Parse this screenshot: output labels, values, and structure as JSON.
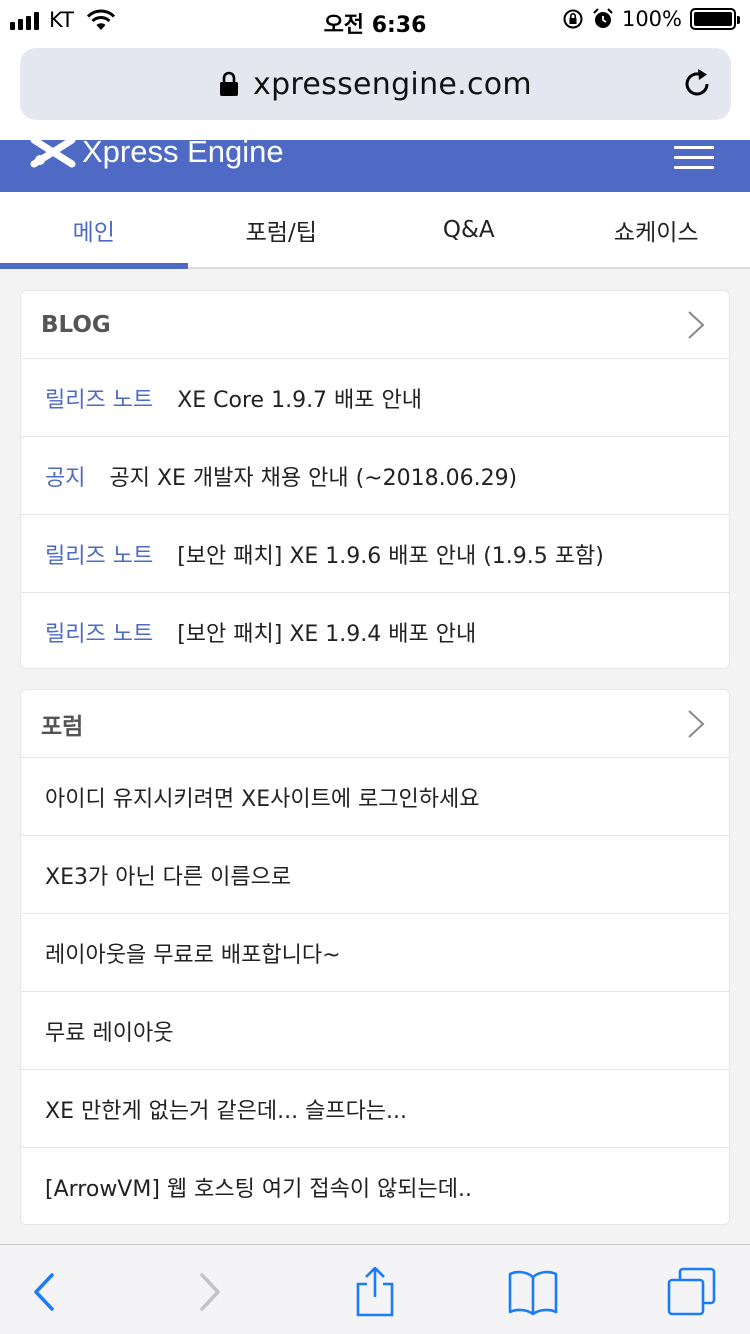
{
  "status_bar": {
    "carrier": "KT",
    "time": "오전 6:36",
    "battery": "100%"
  },
  "browser": {
    "url": "xpressengine.com"
  },
  "site": {
    "logo_text": "Xpress Engine"
  },
  "tabs": [
    {
      "label": "메인",
      "active": true
    },
    {
      "label": "포럼/팁",
      "active": false
    },
    {
      "label": "Q&A",
      "active": false
    },
    {
      "label": "쇼케이스",
      "active": false
    }
  ],
  "blog": {
    "title": "BLOG",
    "items": [
      {
        "category": "릴리즈 노트",
        "title": "XE Core 1.9.7 배포 안내"
      },
      {
        "category": "공지",
        "title": "공지 XE 개발자 채용 안내 (~2018.06.29)"
      },
      {
        "category": "릴리즈 노트",
        "title": "[보안 패치] XE 1.9.6 배포 안내 (1.9.5 포함)"
      },
      {
        "category": "릴리즈 노트",
        "title": "[보안 패치] XE 1.9.4 배포 안내"
      }
    ]
  },
  "forum": {
    "title": "포럼",
    "items": [
      "아이디 유지시키려면 XE사이트에 로그인하세요",
      "XE3가 아닌 다른 이름으로",
      "레이아웃을 무료로 배포합니다~",
      "무료 레이아웃",
      "XE 만한게 없는거 같은데... 슬프다는...",
      "[ArrowVM] 웹 호스팅 여기 접속이 않되는데.."
    ]
  },
  "icons": {
    "lock": "lock-icon",
    "reload": "reload-icon",
    "menu": "hamburger-menu-icon",
    "chevron": "chevron-right-icon",
    "back": "back-icon",
    "forward": "forward-icon",
    "share": "share-icon",
    "bookmarks": "bookmarks-icon",
    "tabs": "tabs-icon"
  },
  "colors": {
    "brand": "#4e6ac5",
    "ios_blue": "#1a7cf7"
  }
}
